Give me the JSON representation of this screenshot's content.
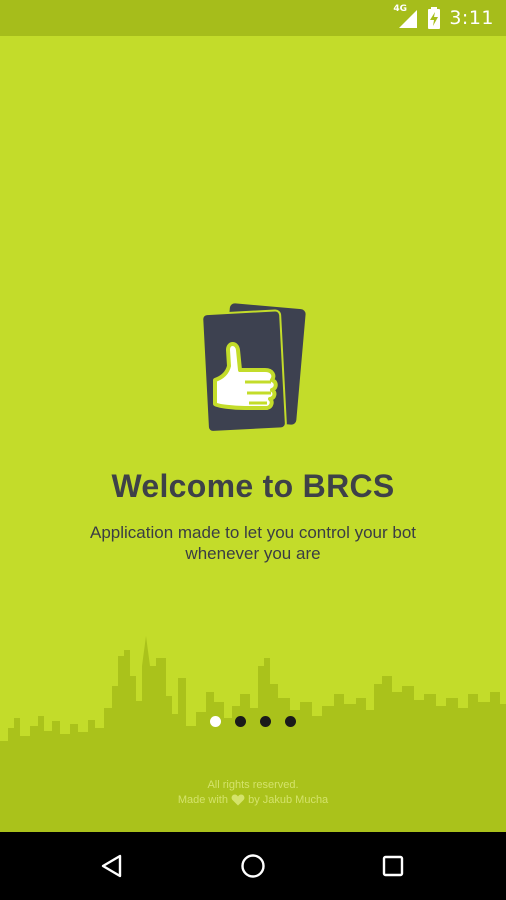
{
  "status_bar": {
    "network": "4G",
    "time": "3:11"
  },
  "onboarding": {
    "title": "Welcome to BRCS",
    "subtitle": "Application made to let you control your bot whenever you are",
    "pager": {
      "total": 4,
      "active_index": 0
    }
  },
  "footer": {
    "rights": "All rights reserved.",
    "made_with_prefix": "Made with",
    "made_with_suffix": "by Jakub Mucha"
  },
  "colors": {
    "background": "#c3dc2a",
    "status_bar": "#a6bd1b",
    "skyline": "#aac21b",
    "text_dark": "#3e4148",
    "card": "#3d4150"
  },
  "icons": [
    "network-4g-icon",
    "signal-icon",
    "battery-charging-icon",
    "thumbs-up-card-logo",
    "heart-icon",
    "back-icon",
    "home-icon",
    "recents-icon"
  ]
}
